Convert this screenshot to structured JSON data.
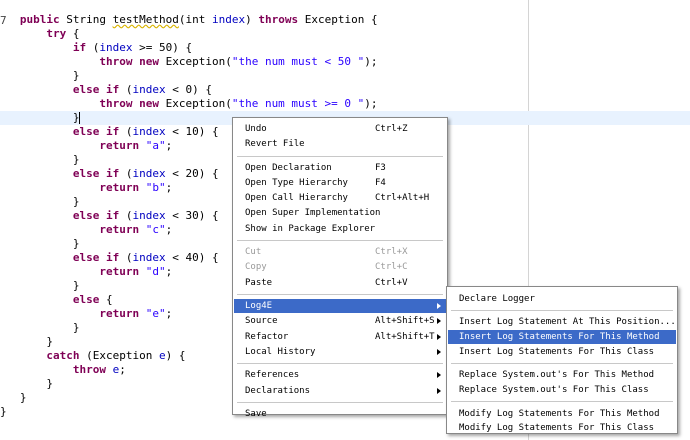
{
  "editor": {
    "gutter_mark": "7",
    "lines": [
      [
        {
          "t": "   "
        },
        {
          "t": "public",
          "c": "kw"
        },
        {
          "t": " String "
        },
        {
          "t": "testMethod",
          "c": "ul"
        },
        {
          "t": "(int "
        },
        {
          "t": "index",
          "c": "var"
        },
        {
          "t": ") "
        },
        {
          "t": "throws",
          "c": "kw"
        },
        {
          "t": " Exception {"
        }
      ],
      [
        {
          "t": "       "
        },
        {
          "t": "try",
          "c": "kw"
        },
        {
          "t": " {"
        }
      ],
      [
        {
          "t": "           "
        },
        {
          "t": "if",
          "c": "kw"
        },
        {
          "t": " ("
        },
        {
          "t": "index",
          "c": "var"
        },
        {
          "t": " >= 50) {"
        }
      ],
      [
        {
          "t": "               "
        },
        {
          "t": "throw",
          "c": "kw"
        },
        {
          "t": " "
        },
        {
          "t": "new",
          "c": "kw"
        },
        {
          "t": " Exception("
        },
        {
          "t": "\"the num must < 50 \"",
          "c": "str"
        },
        {
          "t": ");"
        }
      ],
      [
        {
          "t": "           }"
        }
      ],
      [
        {
          "t": "           "
        },
        {
          "t": "else",
          "c": "kw"
        },
        {
          "t": " "
        },
        {
          "t": "if",
          "c": "kw"
        },
        {
          "t": " ("
        },
        {
          "t": "index",
          "c": "var"
        },
        {
          "t": " < 0) {"
        }
      ],
      [
        {
          "t": "               "
        },
        {
          "t": "throw",
          "c": "kw"
        },
        {
          "t": " "
        },
        {
          "t": "new",
          "c": "kw"
        },
        {
          "t": " Exception("
        },
        {
          "t": "\"the num must >= 0 \"",
          "c": "str"
        },
        {
          "t": ");"
        }
      ],
      [
        {
          "t": "           }"
        }
      ],
      [
        {
          "t": "           "
        },
        {
          "t": "else",
          "c": "kw"
        },
        {
          "t": " "
        },
        {
          "t": "if",
          "c": "kw"
        },
        {
          "t": " ("
        },
        {
          "t": "index",
          "c": "var"
        },
        {
          "t": " < 10) {"
        }
      ],
      [
        {
          "t": "               "
        },
        {
          "t": "return",
          "c": "kw"
        },
        {
          "t": " "
        },
        {
          "t": "\"a\"",
          "c": "str"
        },
        {
          "t": ";"
        }
      ],
      [
        {
          "t": "           }"
        }
      ],
      [
        {
          "t": "           "
        },
        {
          "t": "else",
          "c": "kw"
        },
        {
          "t": " "
        },
        {
          "t": "if",
          "c": "kw"
        },
        {
          "t": " ("
        },
        {
          "t": "index",
          "c": "var"
        },
        {
          "t": " < 20) {"
        }
      ],
      [
        {
          "t": "               "
        },
        {
          "t": "return",
          "c": "kw"
        },
        {
          "t": " "
        },
        {
          "t": "\"b\"",
          "c": "str"
        },
        {
          "t": ";"
        }
      ],
      [
        {
          "t": "           }"
        }
      ],
      [
        {
          "t": "           "
        },
        {
          "t": "else",
          "c": "kw"
        },
        {
          "t": " "
        },
        {
          "t": "if",
          "c": "kw"
        },
        {
          "t": " ("
        },
        {
          "t": "index",
          "c": "var"
        },
        {
          "t": " < 30) {"
        }
      ],
      [
        {
          "t": "               "
        },
        {
          "t": "return",
          "c": "kw"
        },
        {
          "t": " "
        },
        {
          "t": "\"c\"",
          "c": "str"
        },
        {
          "t": ";"
        }
      ],
      [
        {
          "t": "           }"
        }
      ],
      [
        {
          "t": "           "
        },
        {
          "t": "else",
          "c": "kw"
        },
        {
          "t": " "
        },
        {
          "t": "if",
          "c": "kw"
        },
        {
          "t": " ("
        },
        {
          "t": "index",
          "c": "var"
        },
        {
          "t": " < 40) {"
        }
      ],
      [
        {
          "t": "               "
        },
        {
          "t": "return",
          "c": "kw"
        },
        {
          "t": " "
        },
        {
          "t": "\"d\"",
          "c": "str"
        },
        {
          "t": ";"
        }
      ],
      [
        {
          "t": "           }"
        }
      ],
      [
        {
          "t": "           "
        },
        {
          "t": "else",
          "c": "kw"
        },
        {
          "t": " {"
        }
      ],
      [
        {
          "t": "               "
        },
        {
          "t": "return",
          "c": "kw"
        },
        {
          "t": " "
        },
        {
          "t": "\"e\"",
          "c": "str"
        },
        {
          "t": ";"
        }
      ],
      [
        {
          "t": "           }"
        }
      ],
      [
        {
          "t": "       }"
        }
      ],
      [
        {
          "t": "       "
        },
        {
          "t": "catch",
          "c": "kw"
        },
        {
          "t": " (Exception "
        },
        {
          "t": "e",
          "c": "var"
        },
        {
          "t": ") {"
        }
      ],
      [
        {
          "t": "           "
        },
        {
          "t": "throw",
          "c": "kw"
        },
        {
          "t": " "
        },
        {
          "t": "e",
          "c": "var"
        },
        {
          "t": ";"
        }
      ],
      [
        {
          "t": "       }"
        }
      ],
      [
        {
          "t": "   }"
        }
      ],
      [
        {
          "t": "}"
        }
      ]
    ],
    "current_line_index": 7
  },
  "context_menu": {
    "items": [
      {
        "label": "Undo",
        "shortcut": "Ctrl+Z"
      },
      {
        "label": "Revert File",
        "shortcut": ""
      },
      {
        "sep": true
      },
      {
        "label": "Open Declaration",
        "shortcut": "F3"
      },
      {
        "label": "Open Type Hierarchy",
        "shortcut": "F4"
      },
      {
        "label": "Open Call Hierarchy",
        "shortcut": "Ctrl+Alt+H"
      },
      {
        "label": "Open Super Implementation",
        "shortcut": ""
      },
      {
        "label": "Show in Package Explorer",
        "shortcut": ""
      },
      {
        "sep": true
      },
      {
        "label": "Cut",
        "shortcut": "Ctrl+X",
        "disabled": true
      },
      {
        "label": "Copy",
        "shortcut": "Ctrl+C",
        "disabled": true
      },
      {
        "label": "Paste",
        "shortcut": "Ctrl+V"
      },
      {
        "sep": true
      },
      {
        "label": "Log4E",
        "shortcut": "",
        "submenu": true,
        "selected": true
      },
      {
        "label": "Source",
        "shortcut": "Alt+Shift+S",
        "submenu": true
      },
      {
        "label": "Refactor",
        "shortcut": "Alt+Shift+T",
        "submenu": true
      },
      {
        "label": "Local History",
        "shortcut": "",
        "submenu": true
      },
      {
        "sep": true
      },
      {
        "label": "References",
        "shortcut": "",
        "submenu": true
      },
      {
        "label": "Declarations",
        "shortcut": "",
        "submenu": true
      },
      {
        "sep": true
      },
      {
        "label": "Save",
        "shortcut": ""
      }
    ]
  },
  "submenu": {
    "items": [
      {
        "label": "Declare Logger"
      },
      {
        "sep": true
      },
      {
        "label": "Insert Log Statement At This Position..."
      },
      {
        "label": "Insert Log Statements For This Method",
        "selected": true
      },
      {
        "label": "Insert Log Statements For This Class"
      },
      {
        "sep": true
      },
      {
        "label": "Replace System.out's For This Method"
      },
      {
        "label": "Replace System.out's For This Class"
      },
      {
        "sep": true
      },
      {
        "label": "Modify Log Statements For This Method"
      },
      {
        "label": "Modify Log Statements For This Class"
      }
    ]
  },
  "colors": {
    "keyword": "#7f0055",
    "string": "#2a00ff",
    "field": "#0000c0",
    "selection": "#3c6ac8",
    "current_line": "#e8f2fe"
  }
}
